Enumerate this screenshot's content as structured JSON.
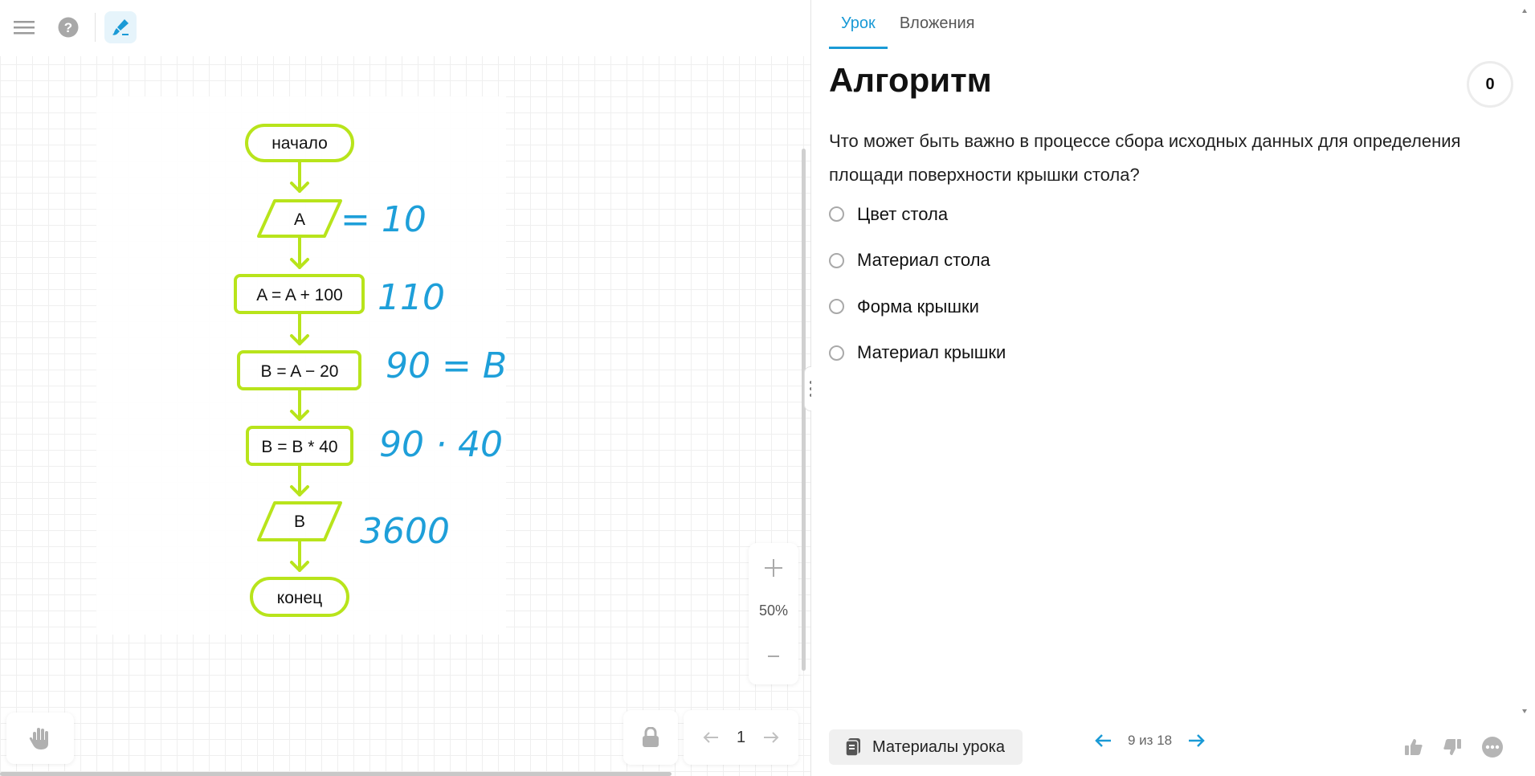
{
  "toolbar": {
    "menu_icon": "hamburger-menu-icon",
    "help_icon": "question-circle-icon",
    "tool_icon": "brush-icon"
  },
  "slide": {
    "flowchart": {
      "start": "начало",
      "input_a": "A",
      "step1": "A = A + 100",
      "step2": "B = A − 20",
      "step3": "B = B * 40",
      "output_b": "B",
      "end": "конец"
    },
    "handwriting": {
      "note1": "= 10",
      "note2": "110",
      "note3": "90 = B",
      "note4": "90 · 40",
      "note5": "3600"
    },
    "colors": {
      "flowchart_green": "#b8e41b",
      "handwriting_blue": "#1e9fd9"
    }
  },
  "zoom": {
    "plus_icon": "plus-icon",
    "level": "50%",
    "minus_icon": "minus-icon"
  },
  "board_footer": {
    "hand_tool_icon": "hand-icon",
    "lock_icon": "lock-icon",
    "page_number": "1"
  },
  "lesson": {
    "tabs": [
      {
        "label": "Урок",
        "active": true
      },
      {
        "label": "Вложения",
        "active": false
      }
    ],
    "title": "Алгоритм",
    "score": "0",
    "question": "Что может быть важно в процессе сбора исходных данных для определения площади поверхности крышки стола?",
    "options": [
      {
        "label": "Цвет стола"
      },
      {
        "label": "Материал стола"
      },
      {
        "label": "Форма крышки"
      },
      {
        "label": "Материал крышки"
      }
    ],
    "materials_label": "Материалы урока",
    "pager_label": "9 из 18",
    "accent_color": "#1a9ad6"
  }
}
